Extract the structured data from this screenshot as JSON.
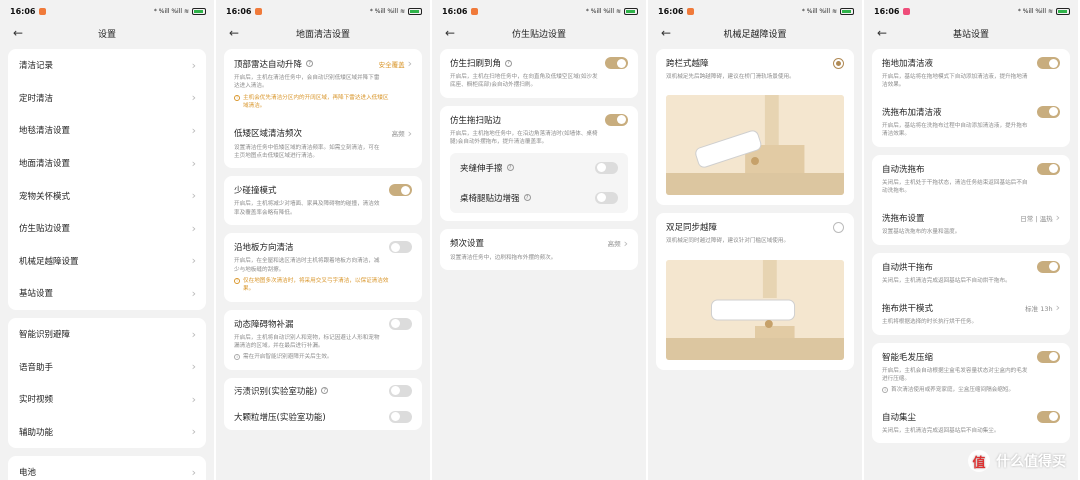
{
  "status": {
    "time": "16:06",
    "icons": "* %ill %ill ≋",
    "battery": ""
  },
  "colors": {
    "accent": "#c8ad7e",
    "warning": "#d9962b"
  },
  "s1": {
    "title": "设置",
    "group1": [
      "清洁记录",
      "定时清洁",
      "地毯清洁设置",
      "地面清洁设置",
      "宠物关怀模式",
      "仿生贴边设置",
      "机械足越障设置",
      "基站设置"
    ],
    "group2": [
      "智能识别避障",
      "语音助手",
      "实时视频",
      "辅助功能"
    ],
    "group3": [
      "电池"
    ]
  },
  "s2": {
    "title": "地面清洁设置",
    "radar_title": "顶部雷达自动升降",
    "radar_value": "安全覆盖",
    "radar_desc": "开启后，主机在清洁任务中，会自动识别低矮区域并降下雷达进入清洁。",
    "radar_warn": "主机会优先清洁分区内的开阔区域，再降下雷达进入低矮区域清洁。",
    "low_title": "低矮区域清洁频次",
    "low_value": "高频",
    "low_desc": "设置清洁任务中低矮区域的清洁频率。如需立刻清洁，可在主页地图点击低矮区域进行清洁。",
    "collision_title": "少碰撞模式",
    "collision_desc": "开启后，主机将减少对墙面、家具及障碍物的碰撞，清洁效率及覆盖率会略有降低。",
    "edge_title": "沿地板方向清洁",
    "edge_desc": "开启后，在全屋和选区清洁时主机将跟着地板方向清洁，减少与地板缝的刮擦。",
    "edge_warn": "仅在地图多次清洁时，将采用交叉弓字清洁，以保证清洁效果。",
    "dynamic_title": "动态障碍物补漏",
    "dynamic_desc": "开启后，主机将自动识别人和宠物，标记因避让人形和宠物漏清洁的区域，并在最后进行补漏。",
    "dynamic_info": "需在开启智能识别避障开关后生效。",
    "stain_title": "污渍识别(实验室功能)",
    "particle_title": "大颗粒增压(实验室功能)"
  },
  "s3": {
    "title": "仿生贴边设置",
    "corner_title": "仿生扫刷到角",
    "corner_desc": "开启后，主机在扫地任务中，在向直角及低矮空区域(如沙发底座、橱柜底部)会自动外摆扫刷。",
    "mop_title": "仿生拖扫贴边",
    "mop_desc": "开启后，主机拖地任务中，在沿边角落清洁时(如墙体、桌椅腿)会自动外摆拖布，提升清洁覆盖率。",
    "sub1": "夹缝伸手擦",
    "sub2": "桌椅腿贴边增强",
    "freq_title": "频次设置",
    "freq_value": "高频",
    "freq_desc": "设置清洁任务中，边刷和拖布外摆的频次。"
  },
  "s4": {
    "title": "机械足越障设置",
    "opt1_title": "跨栏式越障",
    "opt1_desc": "双机械足先后跨越障碍，建议在桥门滑轨场景使用。",
    "opt2_title": "双足同步越障",
    "opt2_desc": "双机械足同时越过障碍，建议针对门槛区域使用。"
  },
  "s5": {
    "title": "基站设置",
    "items": [
      {
        "title": "拖地加清洁液",
        "desc": "开启后，基站将在拖地模式下自动添加清洁液，提升拖地清洁效果。"
      },
      {
        "title": "洗拖布加清洁液",
        "desc": "开启后，基站将在洗拖布过程中自动添加清洁液，提升拖布清洁效果。"
      },
      {
        "title": "自动洗拖布",
        "desc": "关闭后，主机处于干拖状态，清洁任务结束返回基站后不自动洗拖布。"
      },
      {
        "title": "洗拖布设置",
        "value": "日常 | 温热",
        "desc": "设置基站洗拖布的水量和温度。"
      },
      {
        "title": "自动烘干拖布",
        "desc": "关闭后，主机清洁完成返回基站后不自动烘干拖布。"
      },
      {
        "title": "拖布烘干模式",
        "value": "标准 13h",
        "desc": "主机将根据选择的时长执行烘干任务。"
      },
      {
        "title": "智能毛发压缩",
        "desc": "开启后，主机会自动根据尘盒毛发容量状态对尘盒内的毛发进行压缩。",
        "info": "首次清洁使用或养宠家庭，尘盒压缩间隔会缩短。"
      },
      {
        "title": "自动集尘",
        "desc": "关闭后，主机清洁完成返回基站后不自动集尘。"
      }
    ]
  },
  "watermark": {
    "badge": "值",
    "text": "什么值得买"
  }
}
